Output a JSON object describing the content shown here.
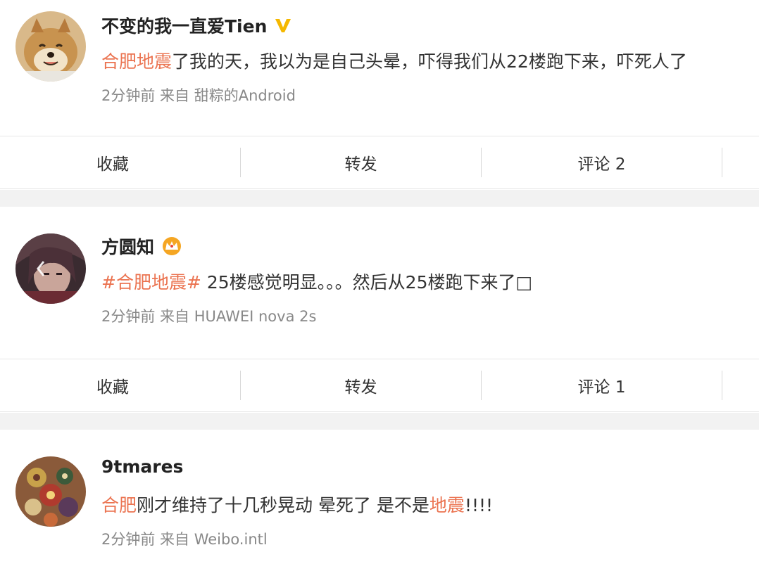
{
  "posts": [
    {
      "username": "不变的我一直爱Tien",
      "badge": "verified-v-icon",
      "content": [
        {
          "text": "合肥地震",
          "style": "kw"
        },
        {
          "text": "了我的天，我以为是自己头晕，吓得我们从22楼跑下来，吓死人了",
          "style": "plain"
        }
      ],
      "meta": "2分钟前 来自 甜粽的Android",
      "actions": [
        "收藏",
        "转发",
        "评论 2"
      ]
    },
    {
      "username": "方圆知",
      "badge": "crown-icon",
      "content": [
        {
          "text": "#",
          "style": "tag"
        },
        {
          "text": "合肥地震",
          "style": "kw"
        },
        {
          "text": "#",
          "style": "tag"
        },
        {
          "text": " 25楼感觉明显。。。然后从25楼跑下来了□",
          "style": "plain"
        }
      ],
      "meta": "2分钟前 来自 HUAWEI nova 2s",
      "actions": [
        "收藏",
        "转发",
        "评论 1"
      ]
    },
    {
      "username": "9tmares",
      "badge": "",
      "content": [
        {
          "text": "合肥",
          "style": "kw"
        },
        {
          "text": "刚才维持了十几秒晃动 晕死了 是不是",
          "style": "plain"
        },
        {
          "text": "地震",
          "style": "kw"
        },
        {
          "text": "!!!!",
          "style": "plain"
        }
      ],
      "meta": "2分钟前 来自 Weibo.intl",
      "actions": []
    }
  ],
  "colors": {
    "keyword": "#eb7350",
    "meta": "#888888",
    "divider": "#d8d8d8",
    "background": "#f2f2f2",
    "verified": "#f5b800",
    "crown": "#f5a623"
  }
}
